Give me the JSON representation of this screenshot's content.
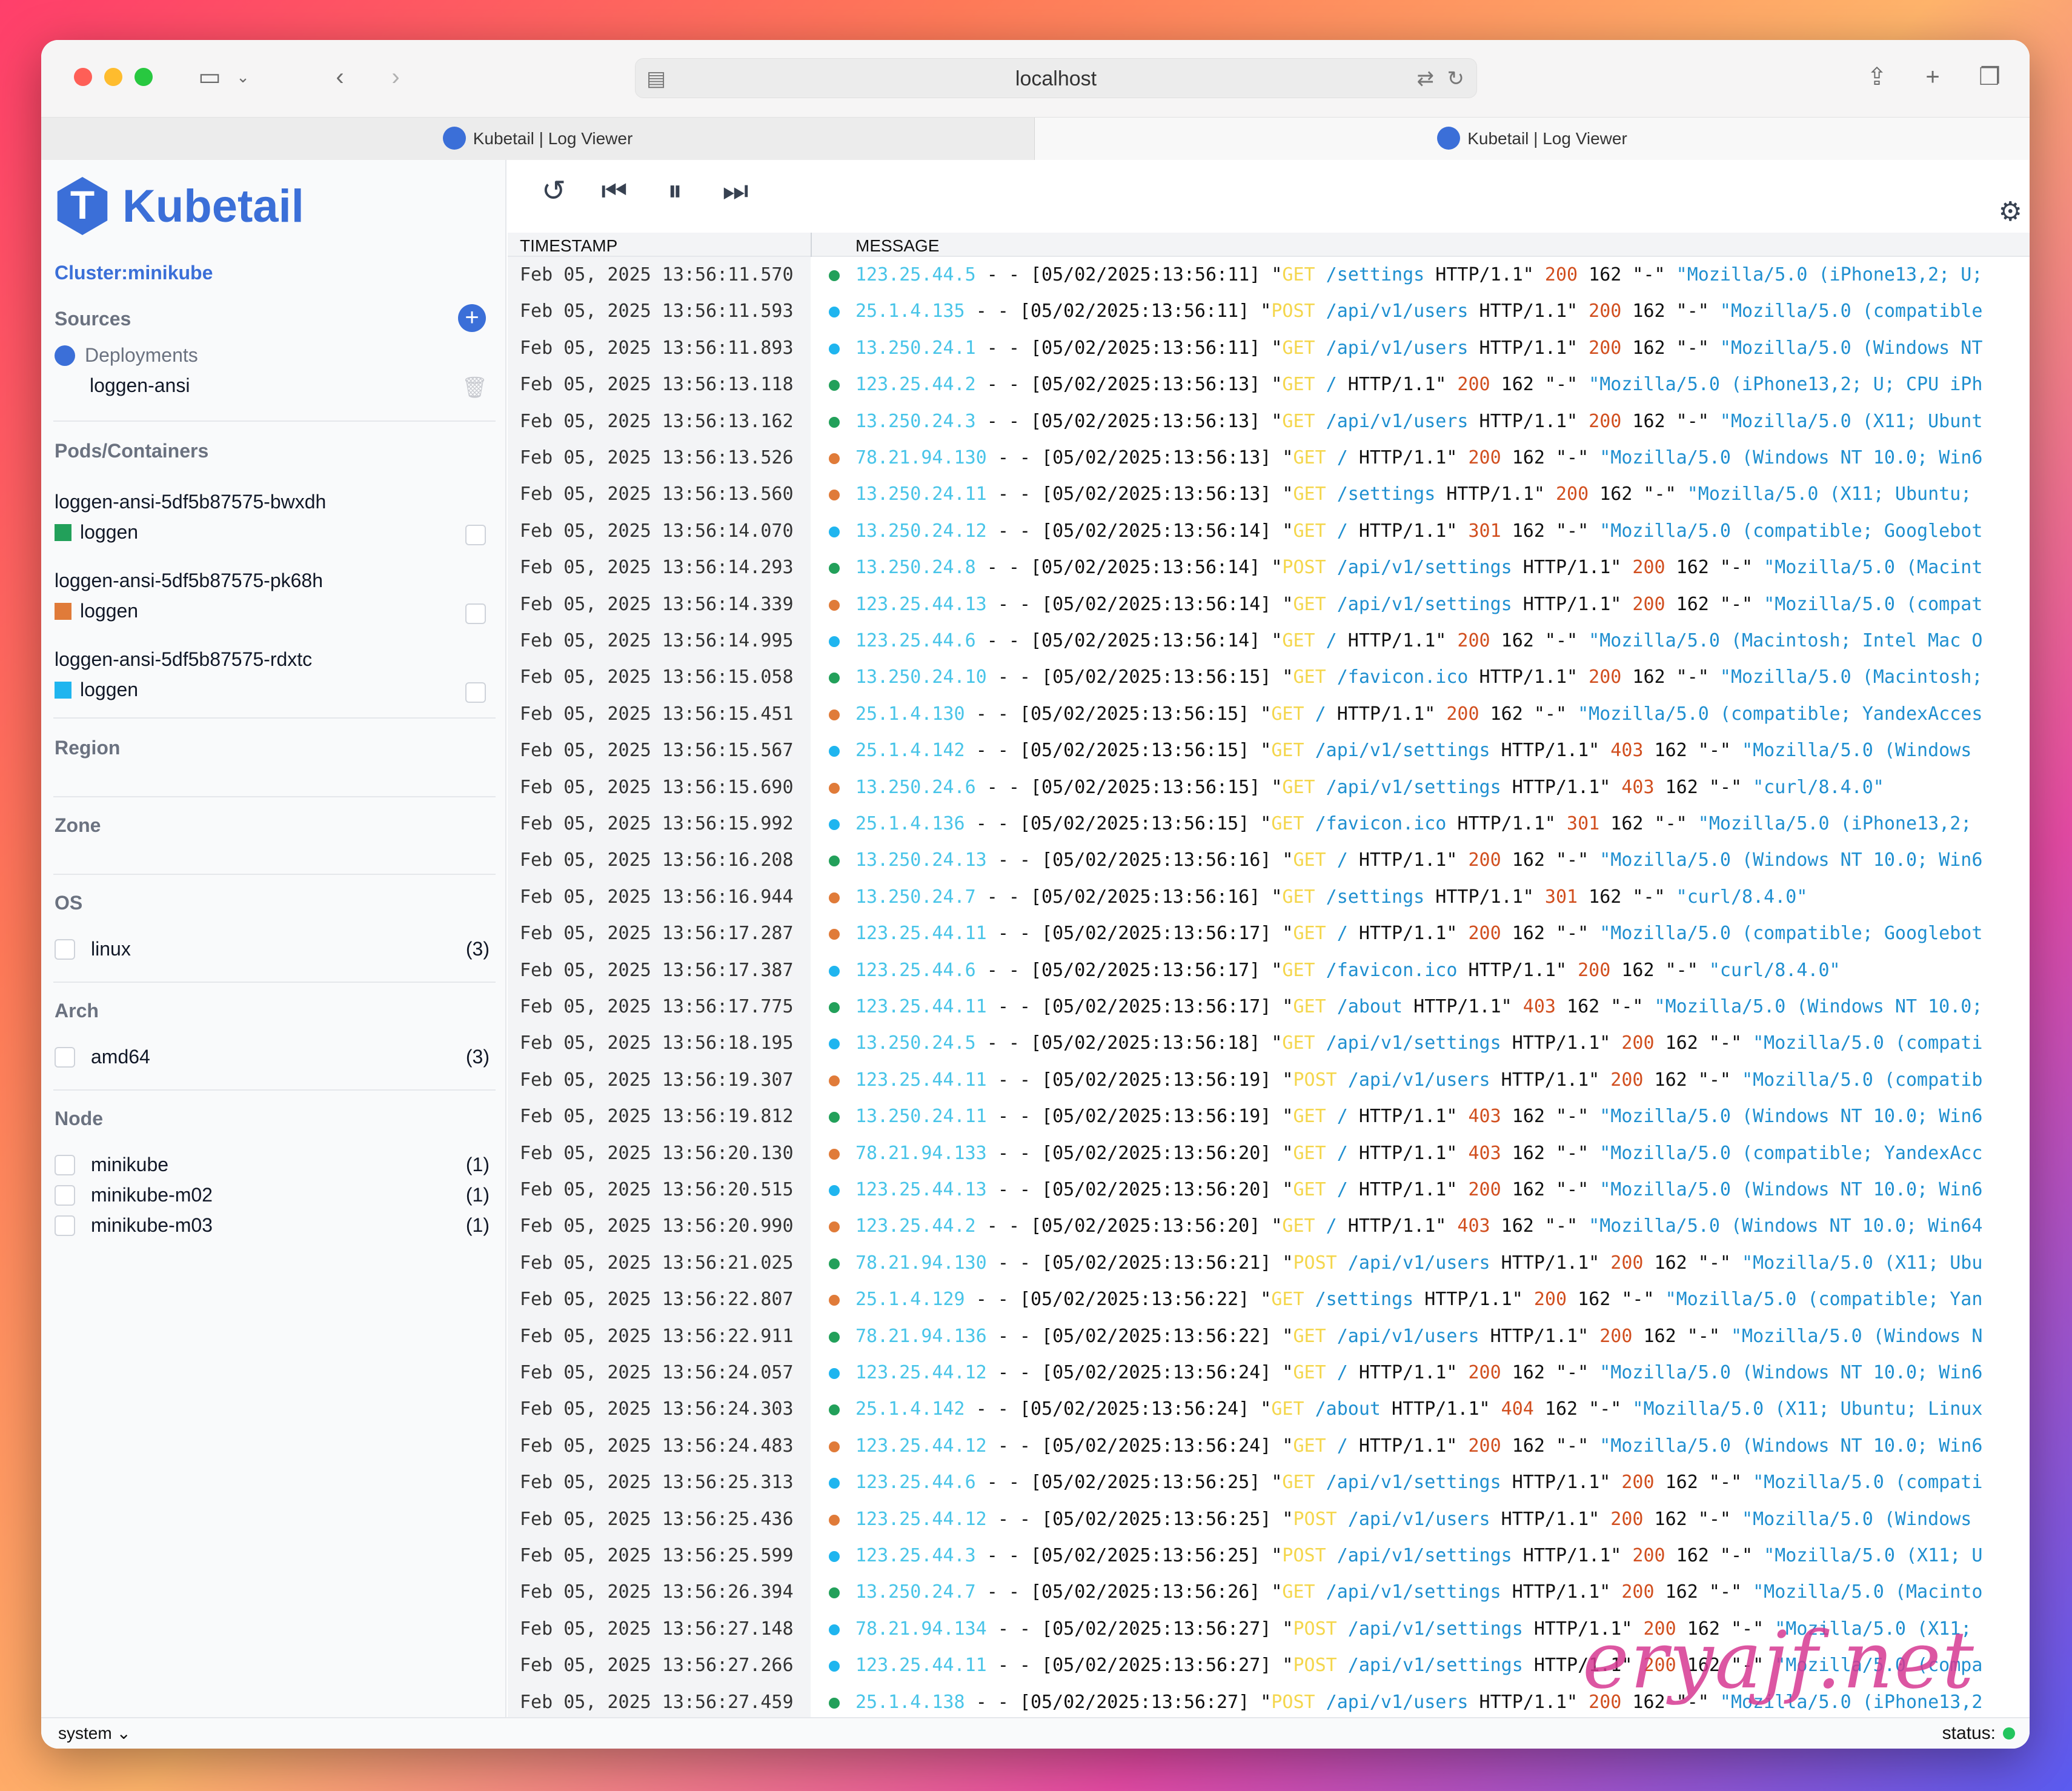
{
  "browser": {
    "url": "localhost",
    "tabs": [
      {
        "title": "Kubetail | Log Viewer"
      },
      {
        "title": "Kubetail | Log Viewer"
      }
    ]
  },
  "sidebar": {
    "brand": "Kubetail",
    "cluster": "Cluster:minikube",
    "sources_label": "Sources",
    "deployments_label": "Deployments",
    "deployment_item": "loggen-ansi",
    "pods_label": "Pods/Containers",
    "pods": [
      {
        "name": "loggen-ansi-5df5b87575-bwxdh",
        "container": "loggen",
        "color": "#22a05a"
      },
      {
        "name": "loggen-ansi-5df5b87575-pk68h",
        "container": "loggen",
        "color": "#e07b39"
      },
      {
        "name": "loggen-ansi-5df5b87575-rdxtc",
        "container": "loggen",
        "color": "#1fb5ef"
      }
    ],
    "region_label": "Region",
    "zone_label": "Zone",
    "os_label": "OS",
    "os_items": [
      {
        "label": "linux",
        "count": "(3)"
      }
    ],
    "arch_label": "Arch",
    "arch_items": [
      {
        "label": "amd64",
        "count": "(3)"
      }
    ],
    "node_label": "Node",
    "node_items": [
      {
        "label": "minikube",
        "count": "(1)"
      },
      {
        "label": "minikube-m02",
        "count": "(1)"
      },
      {
        "label": "minikube-m03",
        "count": "(1)"
      }
    ]
  },
  "footer": {
    "theme": "system",
    "status": "status:"
  },
  "table": {
    "col_timestamp": "TIMESTAMP",
    "col_message": "MESSAGE"
  },
  "colors": {
    "green": "#22a05a",
    "orange": "#e07b39",
    "blue": "#1fb5ef",
    "brand": "#3b6fd8"
  },
  "logs": [
    {
      "ts": "Feb 05, 2025 13:56:11.570",
      "c": "green",
      "ip": "123.25.44.5",
      "dt": "[05/02/2025:13:56:11]",
      "m": "GET",
      "p": "/settings",
      "code": "200",
      "ua": "\"Mozilla/5.0 (iPhone13,2; U;"
    },
    {
      "ts": "Feb 05, 2025 13:56:11.593",
      "c": "blue",
      "ip": "25.1.4.135",
      "dt": "[05/02/2025:13:56:11]",
      "m": "POST",
      "p": "/api/v1/users",
      "code": "200",
      "ua": "\"Mozilla/5.0 (compatible"
    },
    {
      "ts": "Feb 05, 2025 13:56:11.893",
      "c": "blue",
      "ip": "13.250.24.1",
      "dt": "[05/02/2025:13:56:11]",
      "m": "GET",
      "p": "/api/v1/users",
      "code": "200",
      "ua": "\"Mozilla/5.0 (Windows NT"
    },
    {
      "ts": "Feb 05, 2025 13:56:13.118",
      "c": "green",
      "ip": "123.25.44.2",
      "dt": "[05/02/2025:13:56:13]",
      "m": "GET",
      "p": "/",
      "code": "200",
      "ua": "\"Mozilla/5.0 (iPhone13,2; U; CPU iPh"
    },
    {
      "ts": "Feb 05, 2025 13:56:13.162",
      "c": "green",
      "ip": "13.250.24.3",
      "dt": "[05/02/2025:13:56:13]",
      "m": "GET",
      "p": "/api/v1/users",
      "code": "200",
      "ua": "\"Mozilla/5.0 (X11; Ubunt"
    },
    {
      "ts": "Feb 05, 2025 13:56:13.526",
      "c": "orange",
      "ip": "78.21.94.130",
      "dt": "[05/02/2025:13:56:13]",
      "m": "GET",
      "p": "/",
      "code": "200",
      "ua": "\"Mozilla/5.0 (Windows NT 10.0; Win6"
    },
    {
      "ts": "Feb 05, 2025 13:56:13.560",
      "c": "orange",
      "ip": "13.250.24.11",
      "dt": "[05/02/2025:13:56:13]",
      "m": "GET",
      "p": "/settings",
      "code": "200",
      "ua": "\"Mozilla/5.0 (X11; Ubuntu;"
    },
    {
      "ts": "Feb 05, 2025 13:56:14.070",
      "c": "blue",
      "ip": "13.250.24.12",
      "dt": "[05/02/2025:13:56:14]",
      "m": "GET",
      "p": "/",
      "code": "301",
      "ua": "\"Mozilla/5.0 (compatible; Googlebot"
    },
    {
      "ts": "Feb 05, 2025 13:56:14.293",
      "c": "green",
      "ip": "13.250.24.8",
      "dt": "[05/02/2025:13:56:14]",
      "m": "POST",
      "p": "/api/v1/settings",
      "code": "200",
      "ua": "\"Mozilla/5.0 (Macint"
    },
    {
      "ts": "Feb 05, 2025 13:56:14.339",
      "c": "orange",
      "ip": "123.25.44.13",
      "dt": "[05/02/2025:13:56:14]",
      "m": "GET",
      "p": "/api/v1/settings",
      "code": "200",
      "ua": "\"Mozilla/5.0 (compat"
    },
    {
      "ts": "Feb 05, 2025 13:56:14.995",
      "c": "blue",
      "ip": "123.25.44.6",
      "dt": "[05/02/2025:13:56:14]",
      "m": "GET",
      "p": "/",
      "code": "200",
      "ua": "\"Mozilla/5.0 (Macintosh; Intel Mac O"
    },
    {
      "ts": "Feb 05, 2025 13:56:15.058",
      "c": "green",
      "ip": "13.250.24.10",
      "dt": "[05/02/2025:13:56:15]",
      "m": "GET",
      "p": "/favicon.ico",
      "code": "200",
      "ua": "\"Mozilla/5.0 (Macintosh;"
    },
    {
      "ts": "Feb 05, 2025 13:56:15.451",
      "c": "orange",
      "ip": "25.1.4.130",
      "dt": "[05/02/2025:13:56:15]",
      "m": "GET",
      "p": "/",
      "code": "200",
      "ua": "\"Mozilla/5.0 (compatible; YandexAcces"
    },
    {
      "ts": "Feb 05, 2025 13:56:15.567",
      "c": "blue",
      "ip": "25.1.4.142",
      "dt": "[05/02/2025:13:56:15]",
      "m": "GET",
      "p": "/api/v1/settings",
      "code": "403",
      "ua": "\"Mozilla/5.0 (Windows"
    },
    {
      "ts": "Feb 05, 2025 13:56:15.690",
      "c": "orange",
      "ip": "13.250.24.6",
      "dt": "[05/02/2025:13:56:15]",
      "m": "GET",
      "p": "/api/v1/settings",
      "code": "403",
      "ua": "\"curl/8.4.0\""
    },
    {
      "ts": "Feb 05, 2025 13:56:15.992",
      "c": "blue",
      "ip": "25.1.4.136",
      "dt": "[05/02/2025:13:56:15]",
      "m": "GET",
      "p": "/favicon.ico",
      "code": "301",
      "ua": "\"Mozilla/5.0 (iPhone13,2;"
    },
    {
      "ts": "Feb 05, 2025 13:56:16.208",
      "c": "green",
      "ip": "13.250.24.13",
      "dt": "[05/02/2025:13:56:16]",
      "m": "GET",
      "p": "/",
      "code": "200",
      "ua": "\"Mozilla/5.0 (Windows NT 10.0; Win6"
    },
    {
      "ts": "Feb 05, 2025 13:56:16.944",
      "c": "orange",
      "ip": "13.250.24.7",
      "dt": "[05/02/2025:13:56:16]",
      "m": "GET",
      "p": "/settings",
      "code": "301",
      "ua": "\"curl/8.4.0\""
    },
    {
      "ts": "Feb 05, 2025 13:56:17.287",
      "c": "orange",
      "ip": "123.25.44.11",
      "dt": "[05/02/2025:13:56:17]",
      "m": "GET",
      "p": "/",
      "code": "200",
      "ua": "\"Mozilla/5.0 (compatible; Googlebot"
    },
    {
      "ts": "Feb 05, 2025 13:56:17.387",
      "c": "blue",
      "ip": "123.25.44.6",
      "dt": "[05/02/2025:13:56:17]",
      "m": "GET",
      "p": "/favicon.ico",
      "code": "200",
      "ua": "\"curl/8.4.0\""
    },
    {
      "ts": "Feb 05, 2025 13:56:17.775",
      "c": "green",
      "ip": "123.25.44.11",
      "dt": "[05/02/2025:13:56:17]",
      "m": "GET",
      "p": "/about",
      "code": "403",
      "ua": "\"Mozilla/5.0 (Windows NT 10.0;"
    },
    {
      "ts": "Feb 05, 2025 13:56:18.195",
      "c": "blue",
      "ip": "13.250.24.5",
      "dt": "[05/02/2025:13:56:18]",
      "m": "GET",
      "p": "/api/v1/settings",
      "code": "200",
      "ua": "\"Mozilla/5.0 (compati"
    },
    {
      "ts": "Feb 05, 2025 13:56:19.307",
      "c": "orange",
      "ip": "123.25.44.11",
      "dt": "[05/02/2025:13:56:19]",
      "m": "POST",
      "p": "/api/v1/users",
      "code": "200",
      "ua": "\"Mozilla/5.0 (compatib"
    },
    {
      "ts": "Feb 05, 2025 13:56:19.812",
      "c": "green",
      "ip": "13.250.24.11",
      "dt": "[05/02/2025:13:56:19]",
      "m": "GET",
      "p": "/",
      "code": "403",
      "ua": "\"Mozilla/5.0 (Windows NT 10.0; Win6"
    },
    {
      "ts": "Feb 05, 2025 13:56:20.130",
      "c": "orange",
      "ip": "78.21.94.133",
      "dt": "[05/02/2025:13:56:20]",
      "m": "GET",
      "p": "/",
      "code": "403",
      "ua": "\"Mozilla/5.0 (compatible; YandexAcc"
    },
    {
      "ts": "Feb 05, 2025 13:56:20.515",
      "c": "blue",
      "ip": "123.25.44.13",
      "dt": "[05/02/2025:13:56:20]",
      "m": "GET",
      "p": "/",
      "code": "200",
      "ua": "\"Mozilla/5.0 (Windows NT 10.0; Win6"
    },
    {
      "ts": "Feb 05, 2025 13:56:20.990",
      "c": "orange",
      "ip": "123.25.44.2",
      "dt": "[05/02/2025:13:56:20]",
      "m": "GET",
      "p": "/",
      "code": "403",
      "ua": "\"Mozilla/5.0 (Windows NT 10.0; Win64"
    },
    {
      "ts": "Feb 05, 2025 13:56:21.025",
      "c": "green",
      "ip": "78.21.94.130",
      "dt": "[05/02/2025:13:56:21]",
      "m": "POST",
      "p": "/api/v1/users",
      "code": "200",
      "ua": "\"Mozilla/5.0 (X11; Ubu"
    },
    {
      "ts": "Feb 05, 2025 13:56:22.807",
      "c": "orange",
      "ip": "25.1.4.129",
      "dt": "[05/02/2025:13:56:22]",
      "m": "GET",
      "p": "/settings",
      "code": "200",
      "ua": "\"Mozilla/5.0 (compatible; Yan"
    },
    {
      "ts": "Feb 05, 2025 13:56:22.911",
      "c": "green",
      "ip": "78.21.94.136",
      "dt": "[05/02/2025:13:56:22]",
      "m": "GET",
      "p": "/api/v1/users",
      "code": "200",
      "ua": "\"Mozilla/5.0 (Windows N"
    },
    {
      "ts": "Feb 05, 2025 13:56:24.057",
      "c": "blue",
      "ip": "123.25.44.12",
      "dt": "[05/02/2025:13:56:24]",
      "m": "GET",
      "p": "/",
      "code": "200",
      "ua": "\"Mozilla/5.0 (Windows NT 10.0; Win6"
    },
    {
      "ts": "Feb 05, 2025 13:56:24.303",
      "c": "green",
      "ip": "25.1.4.142",
      "dt": "[05/02/2025:13:56:24]",
      "m": "GET",
      "p": "/about",
      "code": "404",
      "ua": "\"Mozilla/5.0 (X11; Ubuntu; Linux"
    },
    {
      "ts": "Feb 05, 2025 13:56:24.483",
      "c": "orange",
      "ip": "123.25.44.12",
      "dt": "[05/02/2025:13:56:24]",
      "m": "GET",
      "p": "/",
      "code": "200",
      "ua": "\"Mozilla/5.0 (Windows NT 10.0; Win6"
    },
    {
      "ts": "Feb 05, 2025 13:56:25.313",
      "c": "blue",
      "ip": "123.25.44.6",
      "dt": "[05/02/2025:13:56:25]",
      "m": "GET",
      "p": "/api/v1/settings",
      "code": "200",
      "ua": "\"Mozilla/5.0 (compati"
    },
    {
      "ts": "Feb 05, 2025 13:56:25.436",
      "c": "orange",
      "ip": "123.25.44.12",
      "dt": "[05/02/2025:13:56:25]",
      "m": "POST",
      "p": "/api/v1/users",
      "code": "200",
      "ua": "\"Mozilla/5.0 (Windows"
    },
    {
      "ts": "Feb 05, 2025 13:56:25.599",
      "c": "blue",
      "ip": "123.25.44.3",
      "dt": "[05/02/2025:13:56:25]",
      "m": "POST",
      "p": "/api/v1/settings",
      "code": "200",
      "ua": "\"Mozilla/5.0 (X11; U"
    },
    {
      "ts": "Feb 05, 2025 13:56:26.394",
      "c": "green",
      "ip": "13.250.24.7",
      "dt": "[05/02/2025:13:56:26]",
      "m": "GET",
      "p": "/api/v1/settings",
      "code": "200",
      "ua": "\"Mozilla/5.0 (Macinto"
    },
    {
      "ts": "Feb 05, 2025 13:56:27.148",
      "c": "blue",
      "ip": "78.21.94.134",
      "dt": "[05/02/2025:13:56:27]",
      "m": "POST",
      "p": "/api/v1/settings",
      "code": "200",
      "ua": "\"Mozilla/5.0 (X11;"
    },
    {
      "ts": "Feb 05, 2025 13:56:27.266",
      "c": "blue",
      "ip": "123.25.44.11",
      "dt": "[05/02/2025:13:56:27]",
      "m": "POST",
      "p": "/api/v1/settings",
      "code": "200",
      "ua": "\"Mozilla/5.0 (compa"
    },
    {
      "ts": "Feb 05, 2025 13:56:27.459",
      "c": "green",
      "ip": "25.1.4.138",
      "dt": "[05/02/2025:13:56:27]",
      "m": "POST",
      "p": "/api/v1/users",
      "code": "200",
      "ua": "\"Mozilla/5.0 (iPhone13,2"
    }
  ],
  "log_fixed": {
    "dash": "- -",
    "proto": "HTTP/1.1\"",
    "size": "162",
    "ref": "\"-\""
  },
  "watermark": "eryajf.net"
}
